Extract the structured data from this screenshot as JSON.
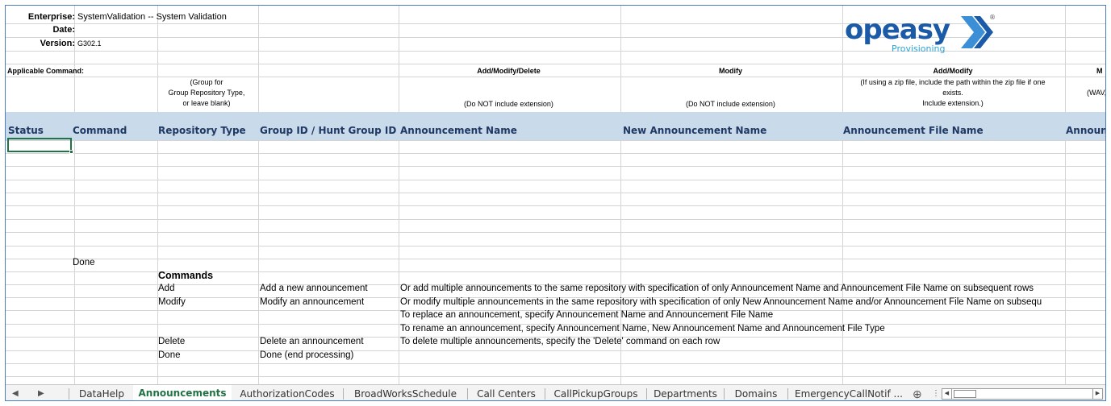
{
  "meta": {
    "enterprise_label": "Enterprise:",
    "enterprise_value": "SystemValidation -- System Validation",
    "date_label": "Date:",
    "version_label": "Version:",
    "version_value": "G302.1"
  },
  "logo": {
    "text": "opeasy",
    "subtitle": "Provisioning",
    "registered": "®"
  },
  "applicable_command_label": "Applicable Command:",
  "command_notes": {
    "announcement_name": "Add/Modify/Delete",
    "new_announcement_name": "Modify",
    "announcement_file_name": "Add/Modify",
    "truncated": "M"
  },
  "hints": {
    "repository_type": [
      "(Group for",
      "Group Repository Type,",
      "or leave blank)"
    ],
    "announcement_name": "(Do NOT include extension)",
    "new_announcement_name": "(Do NOT include extension)",
    "announcement_file_name": [
      "(If using a zip file, include the path within the zip file if one",
      "exists.",
      "Include extension.)"
    ],
    "truncated": "(WAV,"
  },
  "columns": [
    "Status",
    "Command",
    "Repository Type",
    "Group ID / Hunt Group ID",
    "Announcement Name",
    "New Announcement Name",
    "Announcement File Name",
    "Announc"
  ],
  "done_row": "Done",
  "commands_heading": "Commands",
  "commands": [
    {
      "name": "Add",
      "desc": "Add a new announcement",
      "note": "Or add multiple announcements to the same repository with specification of only Announcement Name and Announcement File Name on subsequent rows"
    },
    {
      "name": "Modify",
      "desc": "Modify an announcement",
      "note": "Or modify multiple announcements in the same repository with specification of only New Announcement Name and/or Announcement File Name on subsequ"
    },
    {
      "name": "",
      "desc": "",
      "note": "To replace an announcement, specify Announcement Name and Announcement File Name"
    },
    {
      "name": "",
      "desc": "",
      "note": "To rename an announcement, specify Announcement Name, New Announcement Name and Announcement File Type"
    },
    {
      "name": "Delete",
      "desc": "Delete an announcement",
      "note": "To delete multiple announcements, specify the 'Delete' command on each row"
    },
    {
      "name": "Done",
      "desc": "Done (end processing)",
      "note": ""
    }
  ],
  "tabs": [
    "DataHelp",
    "Announcements",
    "AuthorizationCodes",
    "BroadWorksSchedule",
    "Call Centers",
    "CallPickupGroups",
    "Departments",
    "Domains",
    "EmergencyCallNotif ..."
  ],
  "active_tab": "Announcements",
  "icons": {
    "nav_prev": "triangle-right-icon",
    "add_sheet": "plus-circle-icon",
    "more": "vertical-ellipsis-icon",
    "scroll_left": "scroll-left-icon",
    "scroll_right": "scroll-right-icon"
  },
  "colors": {
    "header_band": "#c9daea",
    "header_text": "#1f3864",
    "selection": "#217346",
    "logo_blue": "#1a5aa6",
    "logo_accent": "#3b8fd6",
    "logo_sub": "#2ea4d6"
  }
}
